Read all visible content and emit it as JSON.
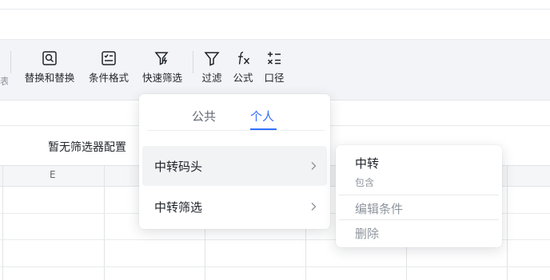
{
  "toolbar": {
    "edge_char": "表",
    "items": [
      {
        "label": "替换和替换",
        "icon": "find-replace-icon"
      },
      {
        "label": "条件格式",
        "icon": "conditional-format-icon"
      },
      {
        "label": "快速筛选",
        "icon": "quick-filter-icon"
      },
      {
        "label": "过滤",
        "icon": "filter-icon"
      },
      {
        "label": "公式",
        "icon": "formula-fx-icon"
      },
      {
        "label": "口径",
        "icon": "caliber-icon"
      }
    ]
  },
  "sheet": {
    "no_filter_text": "暂无筛选器配置",
    "column_letter": "E"
  },
  "filter_popup": {
    "tabs": [
      {
        "label": "公共",
        "active": false
      },
      {
        "label": "个人",
        "active": true
      }
    ],
    "items": [
      {
        "label": "中转码头",
        "hover": true
      },
      {
        "label": "中转筛选",
        "hover": false
      }
    ]
  },
  "condition_popup": {
    "value": "中转",
    "operator": "包含",
    "edit_label": "编辑条件",
    "delete_label": "删除"
  },
  "colors": {
    "accent": "#3370ff",
    "ribbon_bg": "#f3f4f7",
    "muted_text": "#8f959e"
  }
}
